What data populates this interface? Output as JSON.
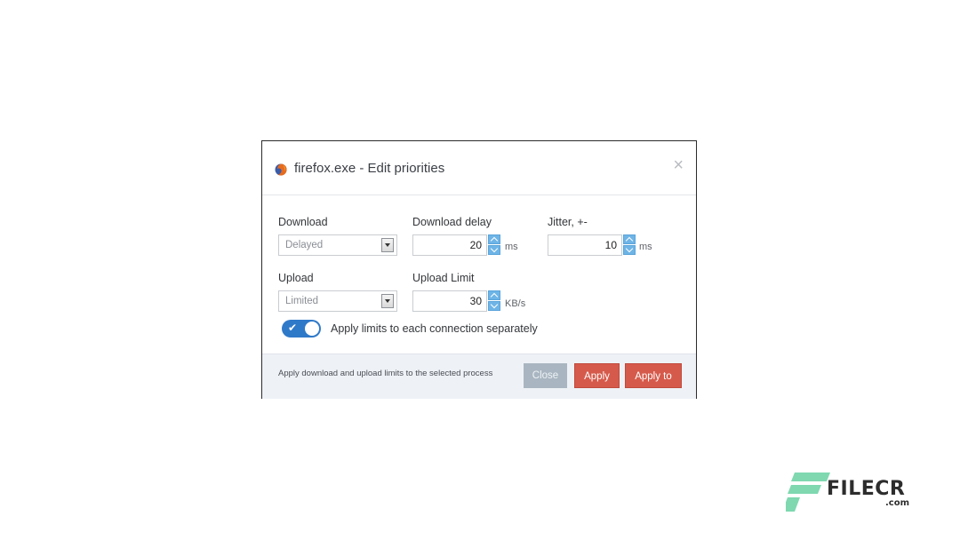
{
  "dialog": {
    "title": "firefox.exe - Edit priorities",
    "close_glyph": "×",
    "app_icon": "firefox-icon"
  },
  "form": {
    "download": {
      "label": "Download",
      "value": "Delayed"
    },
    "download_delay": {
      "label": "Download delay",
      "value": "20",
      "unit": "ms"
    },
    "jitter": {
      "label": "Jitter, +-",
      "value": "10",
      "unit": "ms"
    },
    "upload": {
      "label": "Upload",
      "value": "Limited"
    },
    "upload_limit": {
      "label": "Upload Limit",
      "value": "30",
      "unit": "KB/s"
    },
    "per_connection": {
      "label": "Apply limits to each connection separately",
      "enabled": true
    }
  },
  "footer": {
    "hint": "Apply download and upload limits to the selected process",
    "close_label": "Close",
    "apply_label": "Apply",
    "apply_to_label": "Apply to"
  },
  "watermark": {
    "brand": "FILECR",
    "domain": ".com"
  },
  "colors": {
    "accent_blue": "#2f79c9",
    "spinner_blue": "#6eb4e6",
    "apply_red": "#d65a4b",
    "close_grey": "#a9b6c1",
    "watermark_green": "#7fd8b0"
  }
}
